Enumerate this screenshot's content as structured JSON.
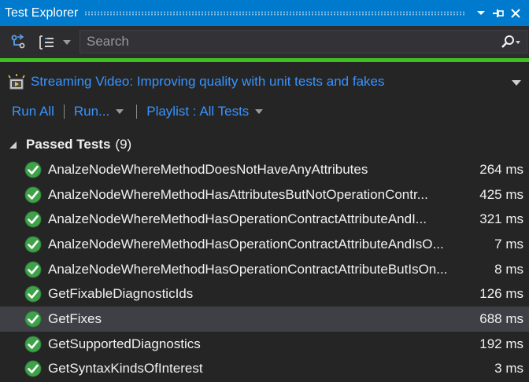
{
  "window": {
    "title": "Test Explorer",
    "dropdown_icon": "chevron-down-icon",
    "pin_icon": "pin-icon",
    "close_icon": "close-icon"
  },
  "toolbar": {
    "group_by_icon": "group-by-icon",
    "view_options_icon": "list-view-icon",
    "search": {
      "placeholder": "Search",
      "value": ""
    },
    "progress": 1.0,
    "progress_color": "#3fbf24"
  },
  "stream": {
    "icon": "lightbulb-icon",
    "link": "Streaming Video: Improving quality with unit tests and fakes"
  },
  "commands": {
    "run_all": "Run All",
    "run": "Run...",
    "playlist": "Playlist : All Tests"
  },
  "group": {
    "name": "Passed Tests",
    "count": "(9)"
  },
  "tests": [
    {
      "name": "AnalzeNodeWhereMethodDoesNotHaveAnyAttributes",
      "duration": "264 ms",
      "selected": false
    },
    {
      "name": "AnalzeNodeWhereMethodHasAttributesButNotOperationContr...",
      "duration": "425 ms",
      "selected": false
    },
    {
      "name": "AnalzeNodeWhereMethodHasOperationContractAttributeAndI...",
      "duration": "321 ms",
      "selected": false
    },
    {
      "name": "AnalzeNodeWhereMethodHasOperationContractAttributeAndIsO...",
      "duration": "7 ms",
      "selected": false
    },
    {
      "name": "AnalzeNodeWhereMethodHasOperationContractAttributeButIsOn...",
      "duration": "8 ms",
      "selected": false
    },
    {
      "name": "GetFixableDiagnosticIds",
      "duration": "126 ms",
      "selected": false
    },
    {
      "name": "GetFixes",
      "duration": "688 ms",
      "selected": true
    },
    {
      "name": "GetSupportedDiagnostics",
      "duration": "192 ms",
      "selected": false
    },
    {
      "name": "GetSyntaxKindsOfInterest",
      "duration": "3 ms",
      "selected": false
    }
  ],
  "colors": {
    "accent": "#007acc",
    "link": "#3794ff",
    "pass": "#3fbf24"
  }
}
